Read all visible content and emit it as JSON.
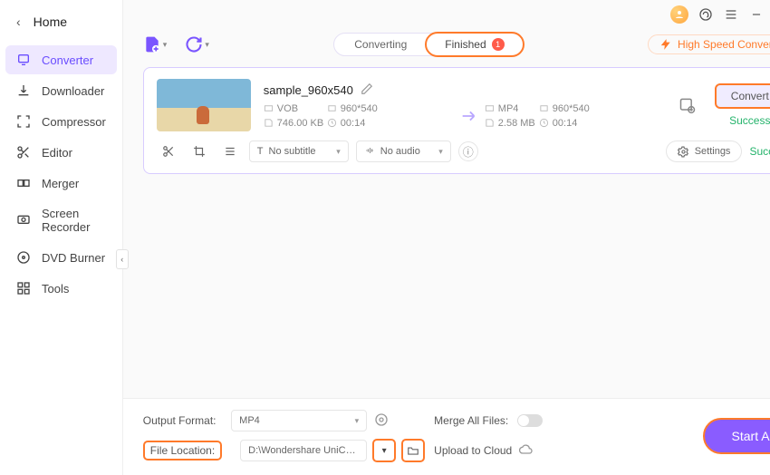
{
  "sidebar": {
    "home": "Home",
    "items": [
      {
        "label": "Converter"
      },
      {
        "label": "Downloader"
      },
      {
        "label": "Compressor"
      },
      {
        "label": "Editor"
      },
      {
        "label": "Merger"
      },
      {
        "label": "Screen Recorder"
      },
      {
        "label": "DVD Burner"
      },
      {
        "label": "Tools"
      }
    ]
  },
  "tabs": {
    "converting": "Converting",
    "finished": "Finished",
    "badge": "1"
  },
  "high_speed": "High Speed Conversion",
  "file": {
    "name": "sample_960x540",
    "src_format": "VOB",
    "src_res": "960*540",
    "src_size": "746.00 KB",
    "src_dur": "00:14",
    "dst_format": "MP4",
    "dst_res": "960*540",
    "dst_size": "2.58 MB",
    "dst_dur": "00:14",
    "convert_btn": "Convert",
    "status": "Success",
    "subtitle": "No subtitle",
    "audio": "No audio",
    "settings": "Settings"
  },
  "footer": {
    "output_format_label": "Output Format:",
    "output_format": "MP4",
    "merge_label": "Merge All Files:",
    "file_location_label": "File Location:",
    "file_location": "D:\\Wondershare UniConverter\\",
    "upload_label": "Upload to Cloud",
    "start_all": "Start All"
  }
}
